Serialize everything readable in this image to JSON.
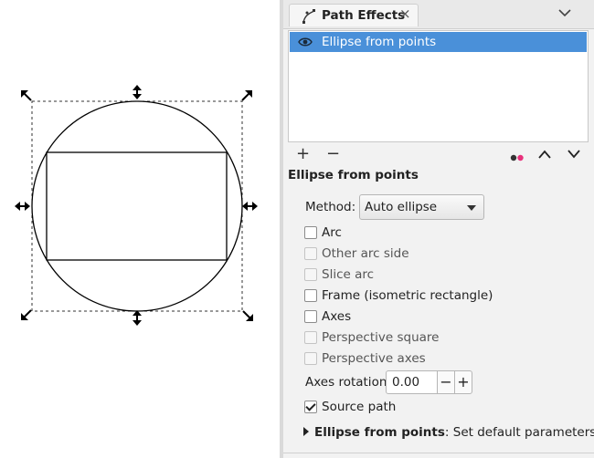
{
  "panel": {
    "tab_title": "Path Effects",
    "tab_close": "×"
  },
  "effects_list": {
    "items": [
      {
        "label": "Ellipse from points",
        "selected": true,
        "visible_icon": "eye-icon"
      }
    ]
  },
  "toolbar": {
    "add_label": "+",
    "remove_label": "−",
    "icons": [
      "add-icon",
      "remove-icon",
      "dots-icon",
      "chevron-up-icon",
      "chevron-down-icon"
    ]
  },
  "effect_settings": {
    "title": "Ellipse from points",
    "method_label": "Method:",
    "method_value": "Auto ellipse",
    "options": [
      {
        "label": "Arc",
        "checked": false,
        "enabled": true
      },
      {
        "label": "Other arc side",
        "checked": false,
        "enabled": false
      },
      {
        "label": "Slice arc",
        "checked": false,
        "enabled": false
      },
      {
        "label": "Frame (isometric rectangle)",
        "checked": false,
        "enabled": true
      },
      {
        "label": "Axes",
        "checked": false,
        "enabled": true
      },
      {
        "label": "Perspective square",
        "checked": false,
        "enabled": false
      },
      {
        "label": "Perspective axes",
        "checked": false,
        "enabled": false
      }
    ],
    "axes_rotation_label": "Axes rotation",
    "axes_rotation_value": "0.00",
    "stepper_minus": "−",
    "stepper_plus": "+",
    "source_path_label": "Source path",
    "source_path_checked": true,
    "expander_bold": "Ellipse from points",
    "expander_rest": ": Set default parameters"
  },
  "colors": {
    "selection": "#4a90d9",
    "dot_dark": "#333333",
    "dot_pink": "#e8317c"
  }
}
